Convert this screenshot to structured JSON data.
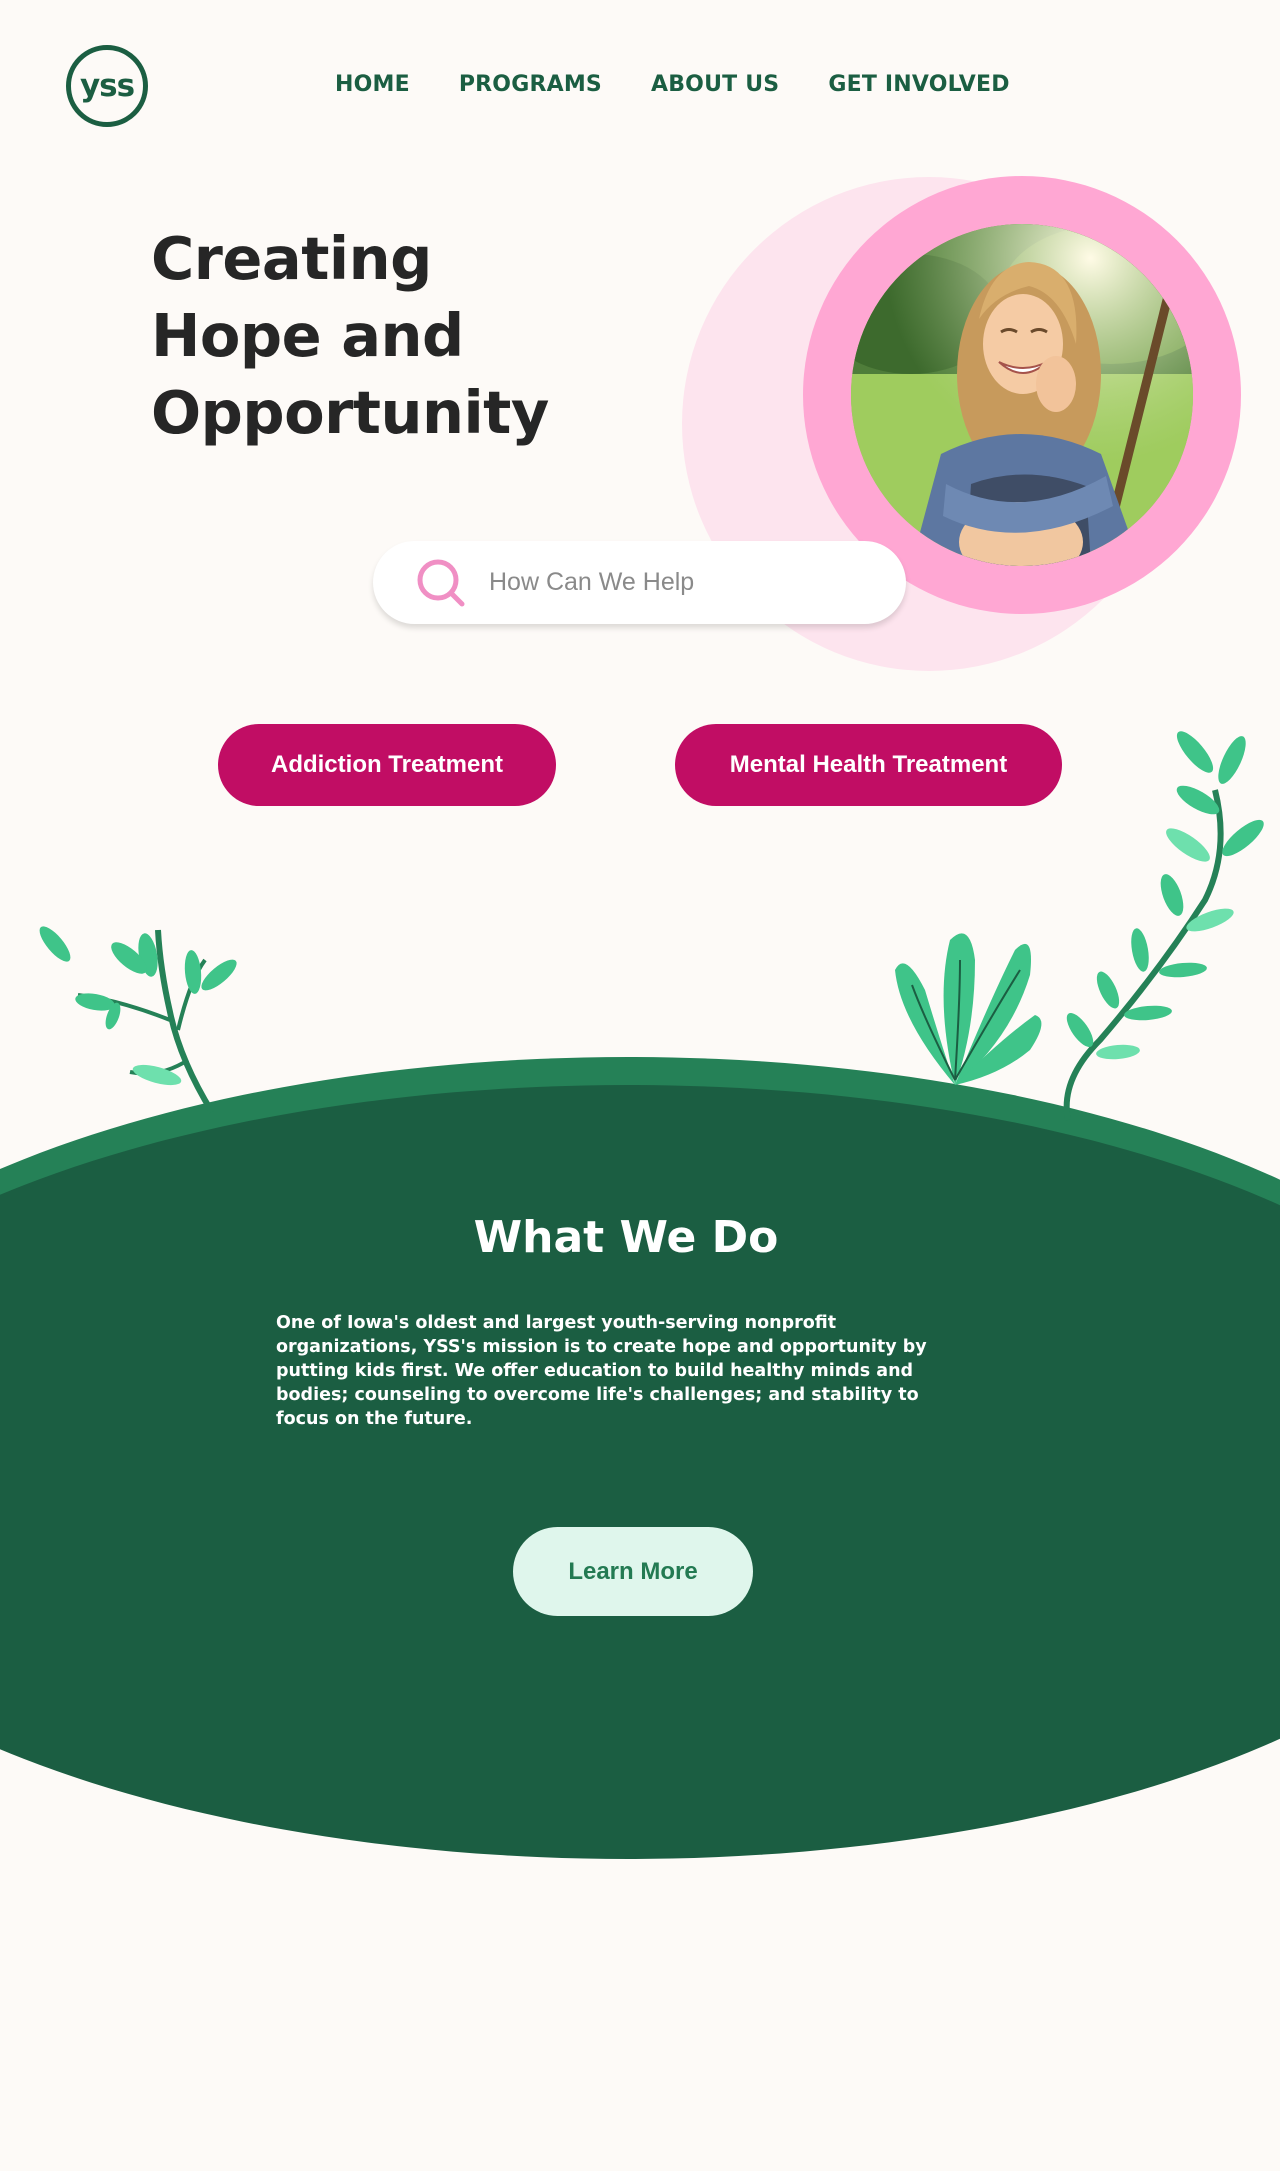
{
  "logo": {
    "text": "yss"
  },
  "nav": {
    "items": [
      {
        "label": "HOME"
      },
      {
        "label": "PROGRAMS"
      },
      {
        "label": "ABOUT US"
      },
      {
        "label": "GET INVOLVED"
      }
    ]
  },
  "hero": {
    "title_line1": "Creating",
    "title_line2": "Hope and",
    "title_line3": "Opportunity",
    "photo_icon": "smiling-young-woman-photo"
  },
  "search": {
    "placeholder": "How Can We Help",
    "value": "",
    "icon": "search-icon"
  },
  "buttons": {
    "addiction": "Addiction Treatment",
    "mental_health": "Mental Health Treatment"
  },
  "what_we_do": {
    "title": "What We Do",
    "body": "One of Iowa's oldest and largest youth-serving nonprofit organizations, YSS's mission is to create hope and opportunity by putting kids first. We offer education to build healthy minds and bodies; counseling to overcome life's challenges; and stability to focus on the future.",
    "cta": "Learn More"
  },
  "colors": {
    "background": "#fdfaf7",
    "brand_green": "#1b5e42",
    "accent_magenta": "#c10d64",
    "accent_pink": "#ffa7d3",
    "light_pink": "#fde4ee",
    "leaf_green": "#3fc489",
    "cta_bg": "#dff6ec"
  }
}
